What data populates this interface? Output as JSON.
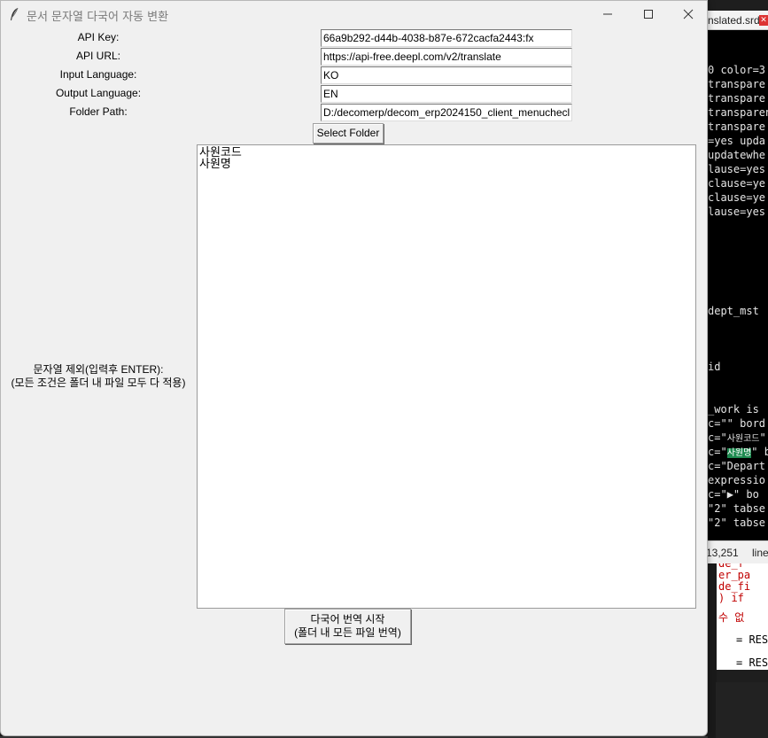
{
  "window": {
    "title": "문서 문자열 다국어 자동 변환"
  },
  "form": {
    "api_key_label": "API Key:",
    "api_key_value": "66a9b292-d44b-4038-b87e-672cacfa2443:fx",
    "api_url_label": "API URL:",
    "api_url_value": "https://api-free.deepl.com/v2/translate",
    "input_lang_label": "Input Language:",
    "input_lang_value": "KO",
    "output_lang_label": "Output Language:",
    "output_lang_value": "EN",
    "folder_path_label": "Folder Path:",
    "folder_path_value": "D:/decomerp/decom_erp2024150_client_menuchecl",
    "select_folder_label": "Select Folder"
  },
  "exclude": {
    "label_line1": "문자열 제외(입력후 ENTER):",
    "label_line2": "(모든 조건은 폴더 내 파일 모두 다 적용)",
    "lines": [
      "사원코드",
      "사원명"
    ]
  },
  "start_button": {
    "line1": "다국어 번역 시작",
    "line2": "(폴더 내 모든 파일 번역)"
  },
  "background_editor": {
    "tab_label": "nslated.srd",
    "tab_close": "✕",
    "code_lines": [
      "0 color=3",
      "transpare",
      "transpare",
      "transparen",
      "transpare",
      "=yes upda",
      "updatewhe",
      "lause=yes",
      "clause=ye",
      "clause=ye",
      "lause=yes",
      "lause=yes",
      "dept_mst",
      "id",
      "_work is",
      "c=\"\" bord",
      "c=\"",
      "사원코드",
      "\"",
      "c=\"",
      "사원명",
      "\" b",
      "c=\"Depart",
      "expressio",
      "c=\"",
      "▶",
      "\" bo",
      "\"2\" tabse",
      "\"2\" tabse"
    ],
    "status_pos": "13,251",
    "status_line": "line",
    "code2_lines": [
      "de_f",
      "er_pa",
      "de_fi",
      ") if",
      "수 없",
      "= RES",
      "= RES"
    ]
  },
  "colors": {
    "window_bg": "#f0f0f0",
    "highlight": "#1e8a50",
    "error_red": "#c00000"
  }
}
